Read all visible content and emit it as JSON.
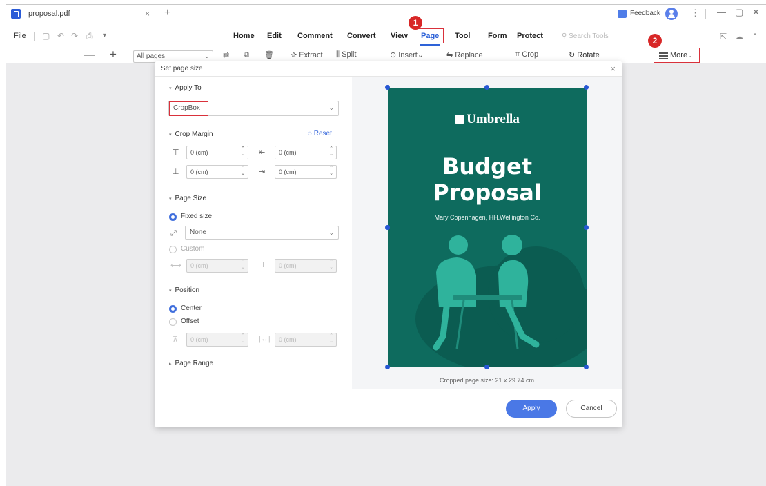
{
  "tab": {
    "title": "proposal.pdf",
    "close": "×",
    "new_tab": "+"
  },
  "titlebar": {
    "feedback": "Feedback",
    "more": "⋮",
    "minimize": "—",
    "maximize": "▢",
    "close": "✕"
  },
  "menu": {
    "file": "File",
    "items": [
      "Home",
      "Edit",
      "Comment",
      "Convert",
      "View",
      "Page",
      "Tool",
      "Form",
      "Protect"
    ],
    "active": "Page",
    "search_placeholder": "Search Tools"
  },
  "toolbar": {
    "zoom_out": "—",
    "zoom_in": "+",
    "pages_select": "All pages",
    "extract": "Extract",
    "split": "Split",
    "insert": "Insert",
    "replace": "Replace",
    "crop": "Crop",
    "rotate": "Rotate",
    "more": "More"
  },
  "badges": {
    "one": "1",
    "two": "2"
  },
  "dialog": {
    "title": "Set page size",
    "close": "×",
    "apply_to": {
      "label": "Apply To",
      "value": "CropBox"
    },
    "crop_margin": {
      "label": "Crop Margin",
      "reset": "Reset",
      "top": "0 (cm)",
      "left": "0 (cm)",
      "bottom": "0 (cm)",
      "right": "0 (cm)"
    },
    "page_size": {
      "label": "Page Size",
      "fixed": "Fixed size",
      "fixed_value": "None",
      "custom": "Custom",
      "width": "0 (cm)",
      "height": "0 (cm)"
    },
    "position": {
      "label": "Position",
      "center": "Center",
      "offset": "Offset",
      "x": "0 (cm)",
      "y": "0 (cm)"
    },
    "page_range": {
      "label": "Page Range"
    },
    "preview": {
      "brand": "Umbrella",
      "title_line1": "Budget",
      "title_line2": "Proposal",
      "author": "Mary Copenhagen, HH.Wellington Co.",
      "cropped_size": "Cropped page size: 21 x 29.74 cm"
    },
    "buttons": {
      "apply": "Apply",
      "cancel": "Cancel"
    }
  },
  "colors": {
    "accent": "#2e63d8",
    "highlight_red": "#d9313b",
    "preview_bg": "#0e6b5e",
    "apply_button": "#4a78e6"
  }
}
